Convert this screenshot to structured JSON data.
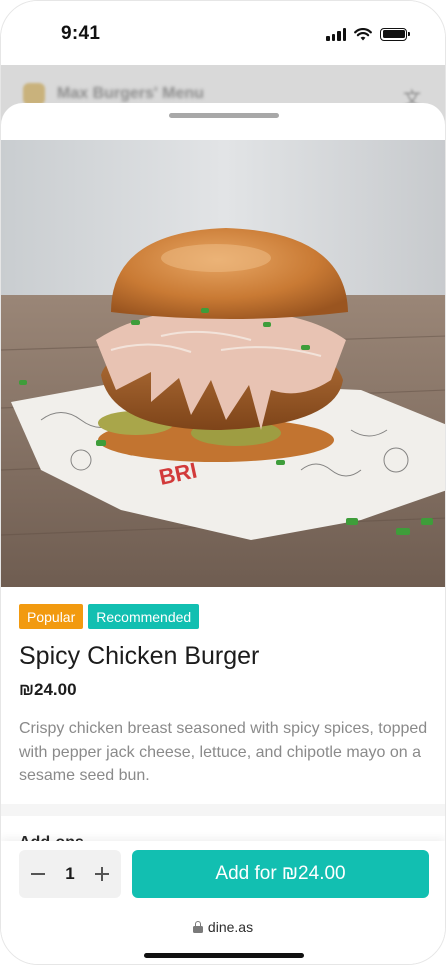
{
  "status_bar": {
    "time": "9:41"
  },
  "background_page": {
    "title": "Max Burgers' Menu"
  },
  "item": {
    "badges": [
      "Popular",
      "Recommended"
    ],
    "title": "Spicy Chicken Burger",
    "price": "₪24.00",
    "description": "Crispy chicken breast seasoned with spicy spices, topped with pepper jack cheese, lettuce, and chipotle mayo on a sesame seed bun.",
    "image_icon": "burger-photo"
  },
  "addons": {
    "heading": "Add-ons"
  },
  "footer": {
    "quantity": "1",
    "add_label": "Add for ₪24.00",
    "url": "dine.as"
  },
  "colors": {
    "accent": "#12bfb1",
    "popular": "#f29a0f",
    "muted_text": "#8a8a8a"
  }
}
